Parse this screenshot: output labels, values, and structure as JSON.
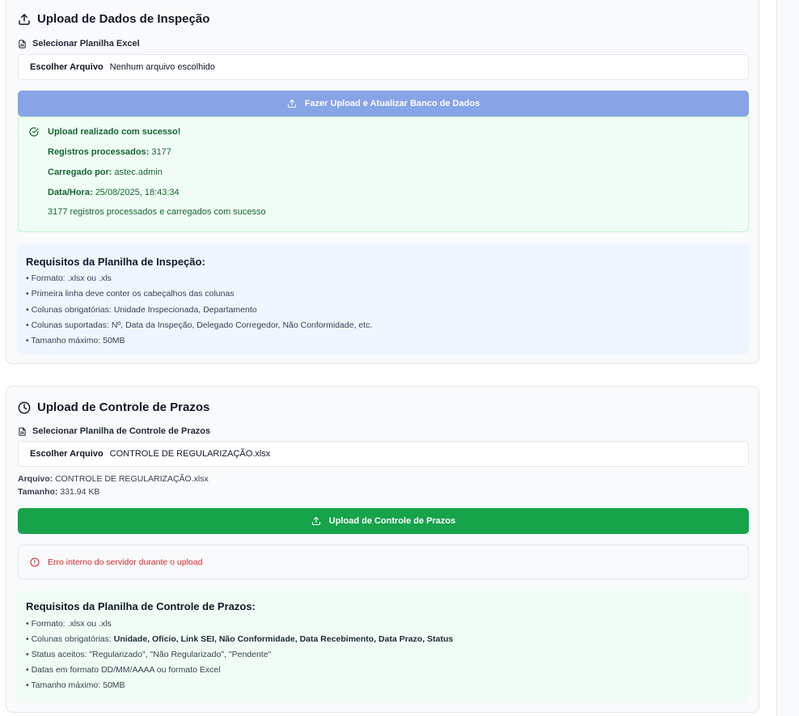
{
  "inspection": {
    "title": "Upload de Dados de Inspeção",
    "select_label": "Selecionar Planilha Excel",
    "file_input": {
      "button": "Escolher Arquivo",
      "value": "Nenhum arquivo escolhido"
    },
    "upload_button": "Fazer Upload e Atualizar Banco de Dados",
    "result": {
      "heading": "Upload realizado com sucesso!",
      "records_label": "Registros processados:",
      "records_value": "3177",
      "loaded_by_label": "Carregado por:",
      "loaded_by_value": "astec.admin",
      "datetime_label": "Data/Hora:",
      "datetime_value": "25/08/2025, 18:43:34",
      "message": "3177 registros processados e carregados com sucesso"
    },
    "requirements": {
      "title": "Requisitos da Planilha de Inspeção:",
      "items": [
        "• Formato: .xlsx ou .xls",
        "• Primeira linha deve conter os cabeçalhos das colunas",
        "• Colunas obrigatórias: Unidade Inspecionada, Departamento",
        "• Colunas suportadas: Nº, Data da Inspeção, Delegado Corregedor, Não Conformidade, etc.",
        "• Tamanho máximo: 50MB"
      ]
    }
  },
  "deadlines": {
    "title": "Upload de Controle de Prazos",
    "select_label": "Selecionar Planilha de Controle de Prazos",
    "file_input": {
      "button": "Escolher Arquivo",
      "value": "CONTROLE DE REGULARIZAÇÃO.xlsx"
    },
    "file_label": "Arquivo:",
    "file_value": "CONTROLE DE REGULARIZAÇÃO.xlsx",
    "size_label": "Tamanho:",
    "size_value": "331.94 KB",
    "upload_button": "Upload de Controle de Prazos",
    "error": "Erro interno do servidor durante o upload",
    "requirements": {
      "title": "Requisitos da Planilha de Controle de Prazos:",
      "item_format": "• Formato: .xlsx ou .xls",
      "item_columns_prefix": "• Colunas obrigatórias: ",
      "item_columns_value": "Unidade, Ofício, Link SEI, Não Conformidade, Data Recebimento, Data Prazo, Status",
      "item_status": "• Status aceitos: \"Regularizado\", \"Não Regularizado\", \"Pendente\"",
      "item_dates": "• Datas em formato DD/MM/AAAA ou formato Excel",
      "item_size": "• Tamanho máximo: 50MB"
    }
  },
  "colors": {
    "success": "#166534",
    "primary_disabled": "#86a4e6",
    "green_button": "#16a34a",
    "error": "#dc2626"
  }
}
